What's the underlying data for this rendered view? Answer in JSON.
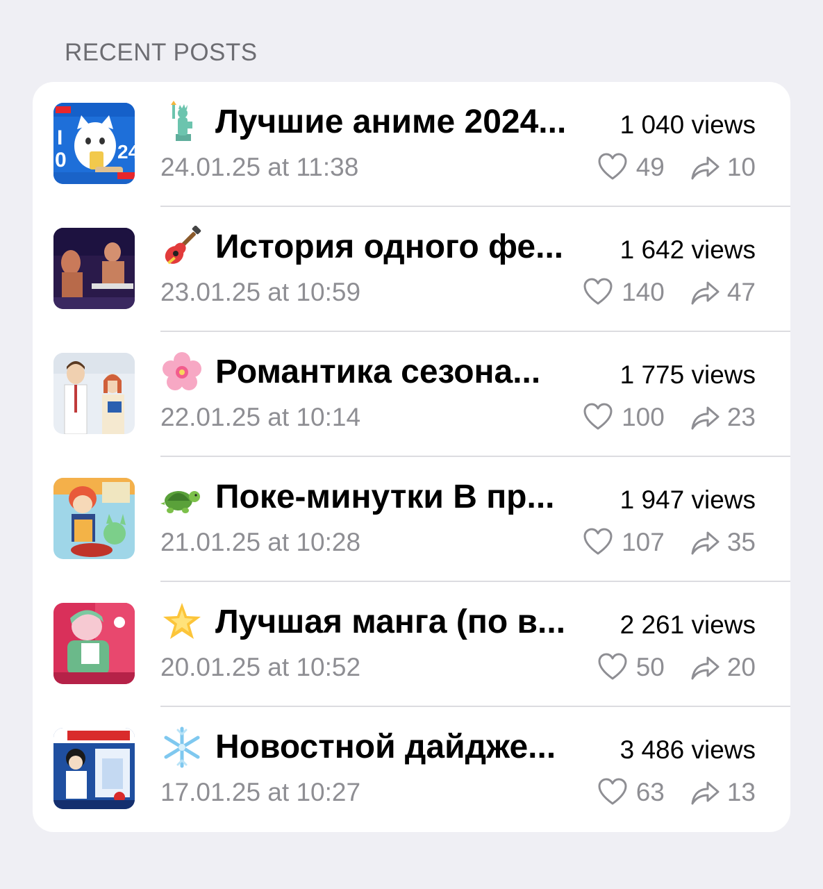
{
  "section": {
    "title": "RECENT POSTS"
  },
  "posts": [
    {
      "emoji": "statue-of-liberty-icon",
      "title": "Лучшие аниме 2024...",
      "views": "1 040 views",
      "date": "24.01.25 at 11:38",
      "likes": "49",
      "shares": "10"
    },
    {
      "emoji": "guitar-icon",
      "title": "История одного фе...",
      "views": "1 642 views",
      "date": "23.01.25 at 10:59",
      "likes": "140",
      "shares": "47"
    },
    {
      "emoji": "cherry-blossom-icon",
      "title": "Романтика сезона...",
      "views": "1 775 views",
      "date": "22.01.25 at 10:14",
      "likes": "100",
      "shares": "23"
    },
    {
      "emoji": "turtle-icon",
      "title": "Поке-минутки В пр...",
      "views": "1 947 views",
      "date": "21.01.25 at 10:28",
      "likes": "107",
      "shares": "35"
    },
    {
      "emoji": "glowing-star-icon",
      "title": "Лучшая манга (по в...",
      "views": "2 261 views",
      "date": "20.01.25 at 10:52",
      "likes": "50",
      "shares": "20"
    },
    {
      "emoji": "snowflake-icon",
      "title": "Новостной дайдже...",
      "views": "3 486 views",
      "date": "17.01.25 at 10:27",
      "likes": "63",
      "shares": "13"
    }
  ],
  "colors": {
    "background": "#efeff4",
    "card": "#ffffff",
    "secondary_text": "#8e8e93",
    "header_text": "#6d6d72",
    "divider": "#dcdce0"
  }
}
